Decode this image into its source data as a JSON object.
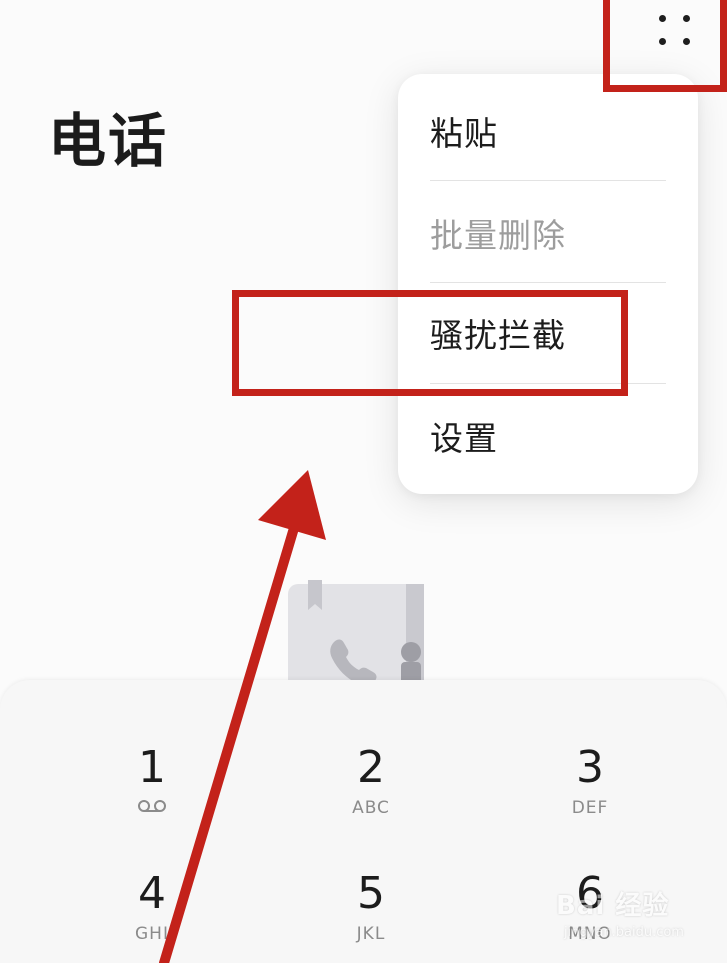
{
  "header": {
    "title": "电话",
    "more_icon": "more-vertical-dots-icon"
  },
  "menu": {
    "items": [
      {
        "label": "粘贴",
        "enabled": true
      },
      {
        "label": "批量删除",
        "enabled": false
      },
      {
        "label": "骚扰拦截",
        "enabled": true,
        "highlighted": true
      },
      {
        "label": "设置",
        "enabled": true
      }
    ]
  },
  "keypad": {
    "keys": [
      {
        "digit": "1",
        "letters": "",
        "icon": "voicemail-icon"
      },
      {
        "digit": "2",
        "letters": "ABC"
      },
      {
        "digit": "3",
        "letters": "DEF"
      },
      {
        "digit": "4",
        "letters": "GHI"
      },
      {
        "digit": "5",
        "letters": "JKL"
      },
      {
        "digit": "6",
        "letters": "MNO"
      }
    ]
  },
  "empty_state": {
    "icon": "contacts-book-phone-icon"
  },
  "annotation": {
    "color": "#c3221a"
  },
  "watermark": {
    "text": "Bai 经验",
    "sub": "jingyan.baidu.com"
  }
}
